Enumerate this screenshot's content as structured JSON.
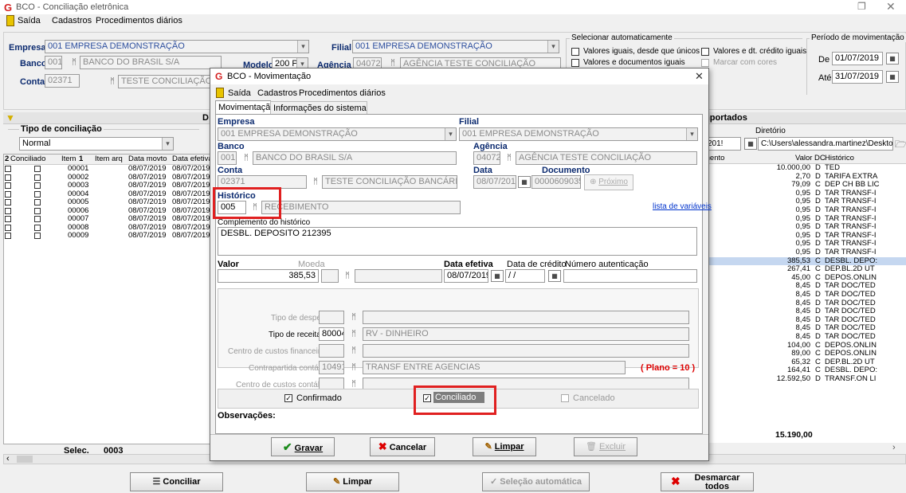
{
  "main_window": {
    "title": "BCO - Conciliação eletrônica",
    "menu": [
      "Saída",
      "Cadastros",
      "Procedimentos diários"
    ],
    "empresa_label": "Empresa",
    "empresa_value": "001 EMPRESA DEMONSTRAÇÃO",
    "filial_label": "Filial",
    "filial_value": "001 EMPRESA DEMONSTRAÇÃO",
    "banco_label": "Banco",
    "banco_code": "001",
    "banco_name": "BANCO DO BRASIL S/A",
    "modelo_label": "Modelo",
    "modelo_value": "200 P.",
    "agencia_label": "Agência",
    "agencia_code": "04072",
    "agencia_name": "AGÊNCIA TESTE CONCILIAÇÃO",
    "conta_label": "Conta",
    "conta_code": "02371",
    "conta_name": "TESTE CONCILIAÇÃO BANC",
    "auto_select": {
      "title": "Selecionar automaticamente",
      "opt1": "Valores iguais, desde que únicos",
      "opt2": "Valores e documentos iguais",
      "opt3": "Valores e dt. crédito iguais",
      "opt4": "Marcar com cores"
    },
    "periodo": {
      "title": "Período de movimentação",
      "de_label": "De",
      "de_value": "01/07/2019",
      "ate_label": "Até",
      "ate_value": "31/07/2019"
    },
    "tipo_conciliacao_label": "Tipo de conciliação",
    "tipo_conciliacao_value": "Normal",
    "left_header": "D",
    "imported_header": "mportados",
    "diretorio_label": "Diretório",
    "diretorio_value": "C:\\Users\\alessandra.martinez\\Desktop\\Arq",
    "date_partial": "201!",
    "left_columns": [
      "Conciliado",
      "Item",
      "Item arq",
      "Data movto",
      "Data efetiva"
    ],
    "left_col_prefix": "2",
    "left_rows": [
      {
        "item": "00001",
        "movto": "08/07/2019",
        "efet": "08/07/2019"
      },
      {
        "item": "00002",
        "movto": "08/07/2019",
        "efet": "08/07/2019"
      },
      {
        "item": "00003",
        "movto": "08/07/2019",
        "efet": "08/07/2019"
      },
      {
        "item": "00004",
        "movto": "08/07/2019",
        "efet": "08/07/2019"
      },
      {
        "item": "00005",
        "movto": "08/07/2019",
        "efet": "08/07/2019"
      },
      {
        "item": "00006",
        "movto": "08/07/2019",
        "efet": "08/07/2019"
      },
      {
        "item": "00007",
        "movto": "08/07/2019",
        "efet": "08/07/2019"
      },
      {
        "item": "00008",
        "movto": "08/07/2019",
        "efet": "08/07/2019"
      },
      {
        "item": "00009",
        "movto": "08/07/2019",
        "efet": "08/07/2019"
      }
    ],
    "right_columns": [
      "mento",
      "Valor",
      "DC",
      "Histórico"
    ],
    "right_rows": [
      {
        "valor": "10.000,00",
        "dc": "D",
        "hist": "TED"
      },
      {
        "valor": "2,70",
        "dc": "D",
        "hist": "TARIFA EXTRA"
      },
      {
        "valor": "79,09",
        "dc": "C",
        "hist": "DEP CH BB LIC"
      },
      {
        "valor": "0,95",
        "dc": "D",
        "hist": "TAR TRANSF-I"
      },
      {
        "valor": "0,95",
        "dc": "D",
        "hist": "TAR TRANSF-I"
      },
      {
        "valor": "0,95",
        "dc": "D",
        "hist": "TAR TRANSF-I"
      },
      {
        "valor": "0,95",
        "dc": "D",
        "hist": "TAR TRANSF-I"
      },
      {
        "valor": "0,95",
        "dc": "D",
        "hist": "TAR TRANSF-I"
      },
      {
        "valor": "0,95",
        "dc": "D",
        "hist": "TAR TRANSF-I"
      },
      {
        "valor": "0,95",
        "dc": "D",
        "hist": "TAR TRANSF-I"
      },
      {
        "valor": "0,95",
        "dc": "D",
        "hist": "TAR TRANSF-I"
      },
      {
        "valor": "385,53",
        "dc": "C",
        "hist": "DESBL. DEPO:"
      },
      {
        "valor": "267,41",
        "dc": "C",
        "hist": "DEP.BL.2D UT"
      },
      {
        "valor": "45,00",
        "dc": "C",
        "hist": "DEPOS.ONLIN"
      },
      {
        "valor": "8,45",
        "dc": "D",
        "hist": "TAR DOC/TED"
      },
      {
        "valor": "8,45",
        "dc": "D",
        "hist": "TAR DOC/TED"
      },
      {
        "valor": "8,45",
        "dc": "D",
        "hist": "TAR DOC/TED"
      },
      {
        "valor": "8,45",
        "dc": "D",
        "hist": "TAR DOC/TED"
      },
      {
        "valor": "8,45",
        "dc": "D",
        "hist": "TAR DOC/TED"
      },
      {
        "valor": "8,45",
        "dc": "D",
        "hist": "TAR DOC/TED"
      },
      {
        "valor": "8,45",
        "dc": "D",
        "hist": "TAR DOC/TED"
      },
      {
        "valor": "104,00",
        "dc": "C",
        "hist": "DEPOS.ONLIN"
      },
      {
        "valor": "89,00",
        "dc": "C",
        "hist": "DEPOS.ONLIN"
      },
      {
        "valor": "65,32",
        "dc": "C",
        "hist": "DEP.BL.2D UT"
      },
      {
        "valor": "164,41",
        "dc": "C",
        "hist": "DESBL. DEPO:"
      },
      {
        "valor": "12.592,50",
        "dc": "D",
        "hist": "TRANSF.ON LI"
      }
    ],
    "right_total": "15.190,00",
    "selec_label": "Selec.",
    "selec_value": "0003",
    "btn_conciliar": "Conciliar",
    "btn_limpar": "Limpar",
    "btn_selecao": "Seleção automática",
    "btn_desmarcar": "Desmarcar todos"
  },
  "dialog": {
    "title": "BCO - Movimentação",
    "menu": [
      "Saída",
      "Cadastros",
      "Procedimentos diários"
    ],
    "tabs": [
      "Movimentação",
      "Informações do sistema"
    ],
    "empresa_label": "Empresa",
    "empresa_value": "001 EMPRESA DEMONSTRAÇÃO",
    "filial_label": "Filial",
    "filial_value": "001 EMPRESA DEMONSTRAÇÃO",
    "banco_label": "Banco",
    "banco_code": "001",
    "banco_name": "BANCO DO BRASIL S/A",
    "agencia_label": "Agência",
    "agencia_code": "04072",
    "agencia_name": "AGÊNCIA TESTE CONCILIAÇÃO",
    "conta_label": "Conta",
    "conta_code": "02371",
    "conta_name": "TESTE CONCILIAÇÃO BANCÁRIA",
    "data_label": "Data",
    "data_value": "08/07/2019",
    "documento_label": "Documento",
    "documento_value": "0000609035",
    "proximo_label": "Próximo",
    "historico_label": "Histórico",
    "historico_code": "005",
    "historico_name": "RECEBIMENTO",
    "lista_variaveis": "lista de variáveis",
    "complemento_label": "Complemento do histórico",
    "complemento_value": "DESBL. DEPOSITO 212395",
    "valor_label": "Valor",
    "valor_value": "385,53",
    "moeda_label": "Moeda",
    "data_efetiva_label": "Data efetiva",
    "data_efetiva_value": "08/07/2019",
    "data_credito_label": "Data de crédito",
    "data_credito_value": "/ /",
    "autenticacao_label": "Número autenticação",
    "tipo_despesa_label": "Tipo de despesa",
    "tipo_receita_label": "Tipo de receita",
    "tipo_receita_code": "80004",
    "tipo_receita_name": "RV - DINHEIRO",
    "centro_fin_label": "Centro de custos financeiro",
    "contrapartida_label": "Contrapartida contábil",
    "contrapartida_code": "10491",
    "contrapartida_name": "TRANSF ENTRE AGENCIAS",
    "plano_label": "( Plano = 10 )",
    "centro_cont_label": "Centro de custos contábil",
    "confirmado_label": "Confirmado",
    "conciliado_label": "Conciliado",
    "cancelado_label": "Cancelado",
    "observacoes_label": "Observações:",
    "btn_gravar": "Gravar",
    "btn_cancelar": "Cancelar",
    "btn_limpar": "Limpar",
    "btn_excluir": "Excluir"
  }
}
